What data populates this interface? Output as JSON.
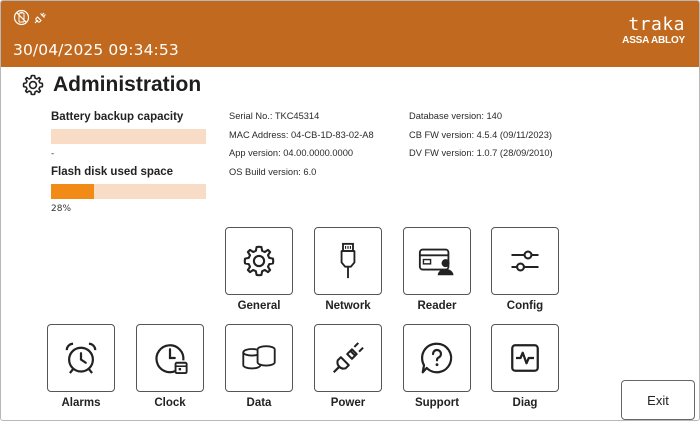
{
  "header": {
    "datetime": "30/04/2025 09:34:53",
    "logo_name": "traka",
    "logo_sub": "ASSA ABLOY",
    "status_icons": [
      "battery-status-icon",
      "power-plug-icon"
    ],
    "bar_color": "#c1691e"
  },
  "page": {
    "title": "Administration",
    "icon": "gear-icon"
  },
  "gauges": {
    "battery": {
      "label": "Battery backup capacity",
      "percent_text": "-",
      "fill": 0
    },
    "flash": {
      "label": "Flash disk used space",
      "percent_text": "28%",
      "fill": 0.28
    }
  },
  "info_left": [
    "Serial No.: TKC45314",
    "MAC Address: 04-CB-1D-83-02-A8",
    "App version:  04.00.0000.0000",
    "OS Build version:  6.0"
  ],
  "info_right": [
    "Database version: 140",
    "CB FW version: 4.5.4 (09/11/2023)",
    "DV FW version: 1.0.7 (28/09/2010)"
  ],
  "tiles_top": [
    {
      "label": "General",
      "icon": "gear-icon"
    },
    {
      "label": "Network",
      "icon": "network-cable-icon"
    },
    {
      "label": "Reader",
      "icon": "card-reader-icon"
    },
    {
      "label": "Config",
      "icon": "sliders-icon"
    }
  ],
  "tiles_bottom": [
    {
      "label": "Alarms",
      "icon": "alarm-clock-icon"
    },
    {
      "label": "Clock",
      "icon": "clock-calendar-icon"
    },
    {
      "label": "Data",
      "icon": "database-icon"
    },
    {
      "label": "Power",
      "icon": "power-plug-icon"
    },
    {
      "label": "Support",
      "icon": "help-bubble-icon"
    },
    {
      "label": "Diag",
      "icon": "diagnostics-icon"
    }
  ],
  "exit_label": "Exit",
  "colors": {
    "accent": "#f28a16",
    "track": "#f8dcc6"
  }
}
